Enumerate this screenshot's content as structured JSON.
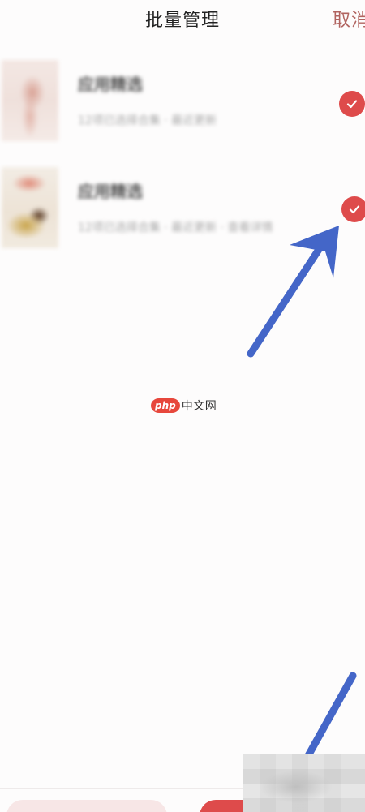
{
  "header": {
    "title": "批量管理",
    "cancel_label": "取消"
  },
  "items": [
    {
      "title": "应用精选",
      "description": "12项已选择合集 · 最近更新",
      "selected": true
    },
    {
      "title": "应用精选",
      "description": "12项已选择合集 · 最近更新 · 查看详情",
      "selected": true
    }
  ],
  "watermark": {
    "badge": "php",
    "text": "中文网"
  },
  "colors": {
    "accent": "#de4b4b",
    "cancel_text": "#b16460",
    "annotation_arrow": "#4466c8"
  },
  "icons": {
    "check": "check-icon"
  }
}
